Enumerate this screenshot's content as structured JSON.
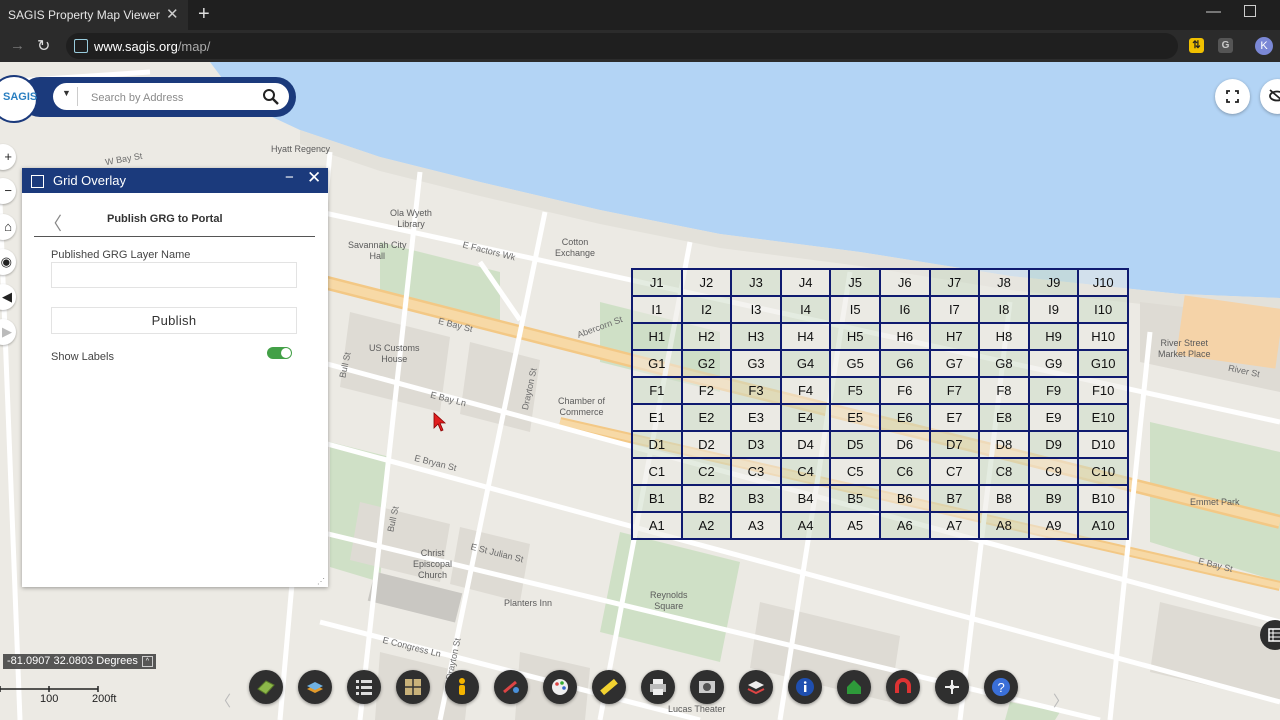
{
  "browser": {
    "tab_title": "SAGIS Property Map Viewer",
    "tab_close": "✕",
    "new_tab": "+",
    "url_host": "www.sagis.org",
    "url_path": "/map/",
    "profile_initial": "K",
    "ext_g": "G"
  },
  "search": {
    "placeholder": "Search by Address",
    "logo_text": "SAGIS"
  },
  "left_tools": {
    "zoom_in": "+",
    "zoom_out": "−",
    "home": "⌂",
    "locate": "◉",
    "back": "◀",
    "forward": "▶"
  },
  "panel": {
    "title": "Grid Overlay",
    "minimize": "−",
    "close": "✕",
    "back": "〈",
    "subtitle": "Publish GRG to Portal",
    "layer_name_label": "Published GRG Layer Name",
    "layer_name_value": "",
    "publish_label": "Publish",
    "show_labels_label": "Show Labels",
    "show_labels_on": true
  },
  "grid": {
    "rows": [
      [
        "J1",
        "J2",
        "J3",
        "J4",
        "J5",
        "J6",
        "J7",
        "J8",
        "J9",
        "J10"
      ],
      [
        "I1",
        "I2",
        "I3",
        "I4",
        "I5",
        "I6",
        "I7",
        "I8",
        "I9",
        "I10"
      ],
      [
        "H1",
        "H2",
        "H3",
        "H4",
        "H5",
        "H6",
        "H7",
        "H8",
        "H9",
        "H10"
      ],
      [
        "G1",
        "G2",
        "G3",
        "G4",
        "G5",
        "G6",
        "G7",
        "G8",
        "G9",
        "G10"
      ],
      [
        "F1",
        "F2",
        "F3",
        "F4",
        "F5",
        "F6",
        "F7",
        "F8",
        "F9",
        "F10"
      ],
      [
        "E1",
        "E2",
        "E3",
        "E4",
        "E5",
        "E6",
        "E7",
        "E8",
        "E9",
        "E10"
      ],
      [
        "D1",
        "D2",
        "D3",
        "D4",
        "D5",
        "D6",
        "D7",
        "D8",
        "D9",
        "D10"
      ],
      [
        "C1",
        "C2",
        "C3",
        "C4",
        "C5",
        "C6",
        "C7",
        "C8",
        "C9",
        "C10"
      ],
      [
        "B1",
        "B2",
        "B3",
        "B4",
        "B5",
        "B6",
        "B7",
        "B8",
        "B9",
        "B10"
      ],
      [
        "A1",
        "A2",
        "A3",
        "A4",
        "A5",
        "A6",
        "A7",
        "A8",
        "A9",
        "A10"
      ]
    ]
  },
  "map_labels": {
    "hyatt": "Hyatt Regency",
    "ola_wyeth": "Ola Wyeth\nLibrary",
    "savannah_city_hall": "Savannah City\nHall",
    "cotton_exchange": "Cotton\nExchange",
    "us_customs": "US Customs\nHouse",
    "chamber": "Chamber of\nCommerce",
    "christ_church": "Christ\nEpiscopal\nChurch",
    "planters_inn": "Planters Inn",
    "reynolds": "Reynolds\nSquare",
    "river_street": "River Street\nMarket Place",
    "emmet_park": "Emmet Park",
    "lucas": "Lucas Theater",
    "e_bay_st": "E Bay St",
    "e_bay_ln": "E Bay Ln",
    "e_bryan_st": "E Bryan St",
    "e_factors_wk": "E Factors Wk",
    "e_congress": "E Congress Ln",
    "e_st_julian": "E St Julian St",
    "drayton_st": "Drayton St",
    "bull_st": "Bull St",
    "abercorn": "Abercorn St",
    "river_st": "River St",
    "w_bay": "W Bay St"
  },
  "bottom": {
    "coords": "-81.0907 32.0803 Degrees",
    "scale_100": "100",
    "scale_200": "200ft",
    "prev": "〈",
    "next": "〉"
  },
  "dock_icons": [
    "basemap-icon",
    "layers-icon",
    "layer-list-icon",
    "grid-overlay-icon",
    "street-view-icon",
    "draw-icon",
    "palette-icon",
    "measure-icon",
    "print-icon",
    "screening-icon",
    "parcel-icon",
    "info-icon",
    "property-icon",
    "magnet-icon",
    "share-icon",
    "help-icon"
  ],
  "colors": {
    "brand": "#1b3a7c",
    "grid_line": "#0f1a6f",
    "water": "#b3d4f5",
    "toggle_on": "#43a047"
  }
}
